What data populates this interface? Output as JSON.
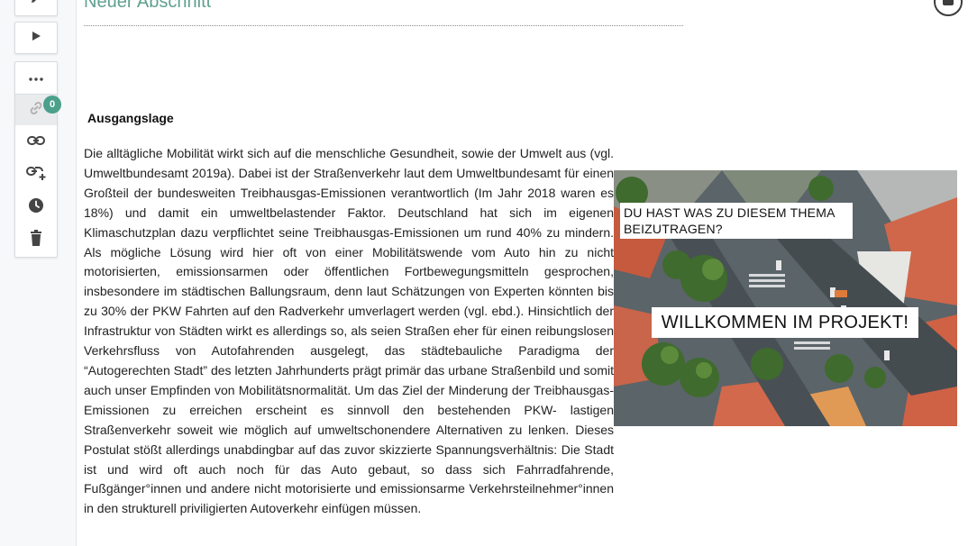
{
  "section": {
    "title": "Neuer Abschnitt"
  },
  "toolbar": {
    "buttons": [
      {
        "icon": "pencil-icon"
      },
      {
        "icon": "play-icon"
      }
    ],
    "panel_items": [
      {
        "icon": "more-icon"
      },
      {
        "icon": "link-icon",
        "badge": "0",
        "active": true
      },
      {
        "icon": "link-icon"
      },
      {
        "icon": "link-add-icon"
      },
      {
        "icon": "clock-icon"
      },
      {
        "icon": "trash-icon"
      }
    ]
  },
  "content": {
    "heading": "Ausgangslage",
    "paragraph": "Die alltägliche Mobilität wirkt sich auf die menschliche Gesundheit, sowie der Umwelt aus (vgl. Umweltbundesamt 2019a). Dabei ist der Straßenverkehr laut dem Umweltbundesamt für einen Großteil der bundesweiten Treibhausgas-Emissionen verantwortlich (Im Jahr 2018 waren es 18%) und damit ein umweltbelastender Faktor. Deutschland hat sich im eigenen Klimaschutzplan dazu verpflichtet seine Treibhausgas-Emissionen um rund 40% zu mindern. Als mögliche Lösung wird hier oft von einer Mobilitätswende vom Auto hin zu nicht motorisierten, emissionsarmen oder öffentlichen Fortbewegungsmitteln gesprochen, insbesondere im städtischen Ballungsraum, denn laut Schätzungen von Experten könnten bis zu 30% der PKW Fahrten auf den Radverkehr umverlagert werden (vgl. ebd.). Hinsichtlich der Infrastruktur von Städten wirkt es allerdings so, als seien Straßen eher für einen reibungslosen Verkehrsfluss von Autofahrenden ausgelegt, das städtebauliche Paradigma der “Autogerechten Stadt” des letzten Jahrhunderts prägt primär das urbane Straßenbild und somit auch unser Empfinden von Mobilitätsnormalität. Um das Ziel der Minderung der Treibhausgas-Emissionen zu erreichen erscheint es sinnvoll den bestehenden PKW- lastigen Straßenverkehr soweit wie möglich auf umweltschonendere Alternativen zu lenken. Dieses Postulat stößt allerdings unabdingbar auf das zuvor skizzierte Spannungsverhältnis: Die Stadt ist und wird oft auch noch für das Auto gebaut, so dass sich Fahrradfahrende, Fußgänger°innen und andere nicht motorisierte und emissionsarme Verkehrsteilnehmer°innen in den strukturell priviligierten Autoverkehr einfügen müssen."
  },
  "banner": {
    "caption_top": "DU HAST WAS ZU DIESEM THEMA BEIZUTRAGEN?",
    "caption_main": "WILLKOMMEN IM PROJEKT!"
  },
  "colors": {
    "accent": "#4aa08a",
    "title": "#5fa08e"
  }
}
